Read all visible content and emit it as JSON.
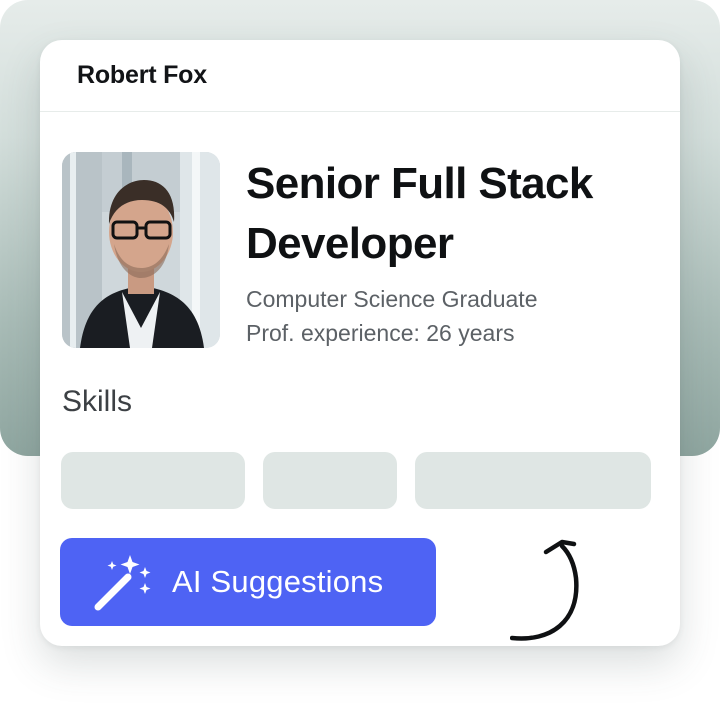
{
  "profile": {
    "name": "Robert Fox",
    "title": "Senior Full Stack Developer",
    "education": "Computer Science Graduate",
    "experience": "Prof. experience: 26 years"
  },
  "skills": {
    "label": "Skills",
    "chips": [
      "",
      "",
      ""
    ]
  },
  "action": {
    "label": "AI Suggestions",
    "icon": "magic-wand-icon",
    "color": "#4e63f4"
  },
  "colors": {
    "backdrop": "#a9bcb7",
    "chip": "#dfe6e4",
    "text": "#121417"
  }
}
